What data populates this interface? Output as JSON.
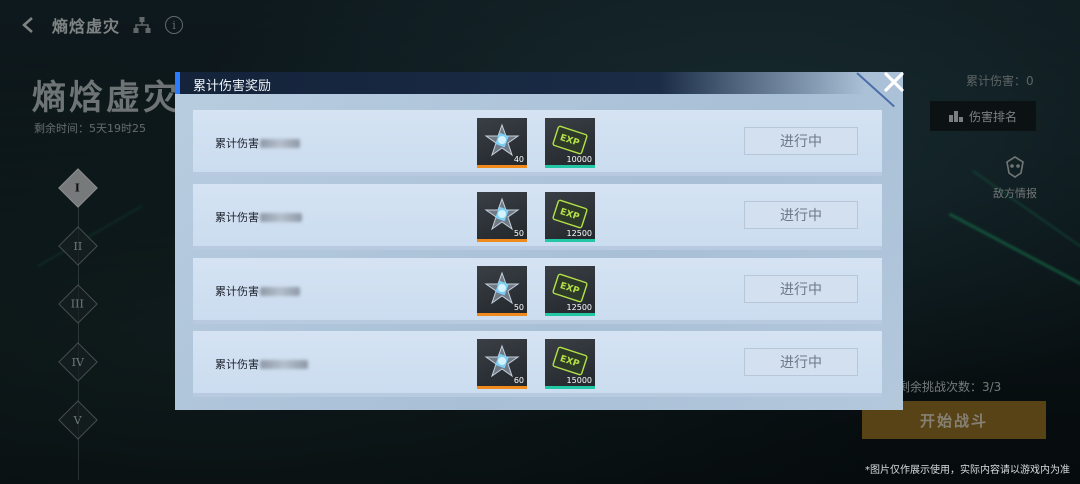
{
  "background": {
    "topbar_title": "熵焓虚灾",
    "event_title": "熵焓虚灾",
    "remaining_time": "剩余时间：5天19时25",
    "levels": [
      "I",
      "II",
      "III",
      "IV",
      "V"
    ],
    "total_damage": "累计伤害：0",
    "rank_button": "伤害排名",
    "enemy_intel": "敌方情报",
    "challenges_left": "剩余挑战次数：3/3",
    "start_button": "开始战斗",
    "disclaimer": "*图片仅作展示使用，实际内容请以游戏内为准"
  },
  "modal": {
    "title": "累计伤害奖励",
    "close_icon": "close-icon",
    "rows": [
      {
        "label": "累计伤害",
        "rewards": [
          {
            "icon": "star-crystal-icon",
            "count": "40"
          },
          {
            "icon": "exp-card-icon",
            "count": "10000"
          }
        ],
        "status": "进行中"
      },
      {
        "label": "累计伤害",
        "rewards": [
          {
            "icon": "star-crystal-icon",
            "count": "50"
          },
          {
            "icon": "exp-card-icon",
            "count": "12500"
          }
        ],
        "status": "进行中"
      },
      {
        "label": "累计伤害",
        "rewards": [
          {
            "icon": "star-crystal-icon",
            "count": "50"
          },
          {
            "icon": "exp-card-icon",
            "count": "12500"
          }
        ],
        "status": "进行中"
      },
      {
        "label": "累计伤害",
        "rewards": [
          {
            "icon": "star-crystal-icon",
            "count": "60"
          },
          {
            "icon": "exp-card-icon",
            "count": "15000"
          }
        ],
        "status": "进行中"
      }
    ]
  },
  "colors": {
    "accent_blue": "#2a7bff",
    "star_rarity": "#f08a1c",
    "exp_rarity": "#22c7a6",
    "start_button": "#a07a2a",
    "exp_green": "#b4e04a"
  }
}
